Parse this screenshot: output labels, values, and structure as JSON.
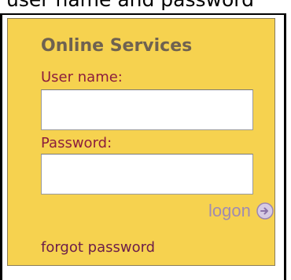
{
  "page": {
    "cut_caption": "user name and password"
  },
  "login_panel": {
    "title": "Online Services",
    "username_label": "User name:",
    "username_value": "",
    "password_label": "Password:",
    "password_value": "",
    "logon_label": "logon",
    "logon_icon": "arrow-right-circle-icon",
    "forgot_label": "forgot password"
  },
  "colors": {
    "panel_background": "#f6d24f",
    "title_text": "#6f6250",
    "label_text": "#8c1d3d",
    "logon_text": "#a08cb0",
    "forgot_text": "#6b1d4a"
  }
}
